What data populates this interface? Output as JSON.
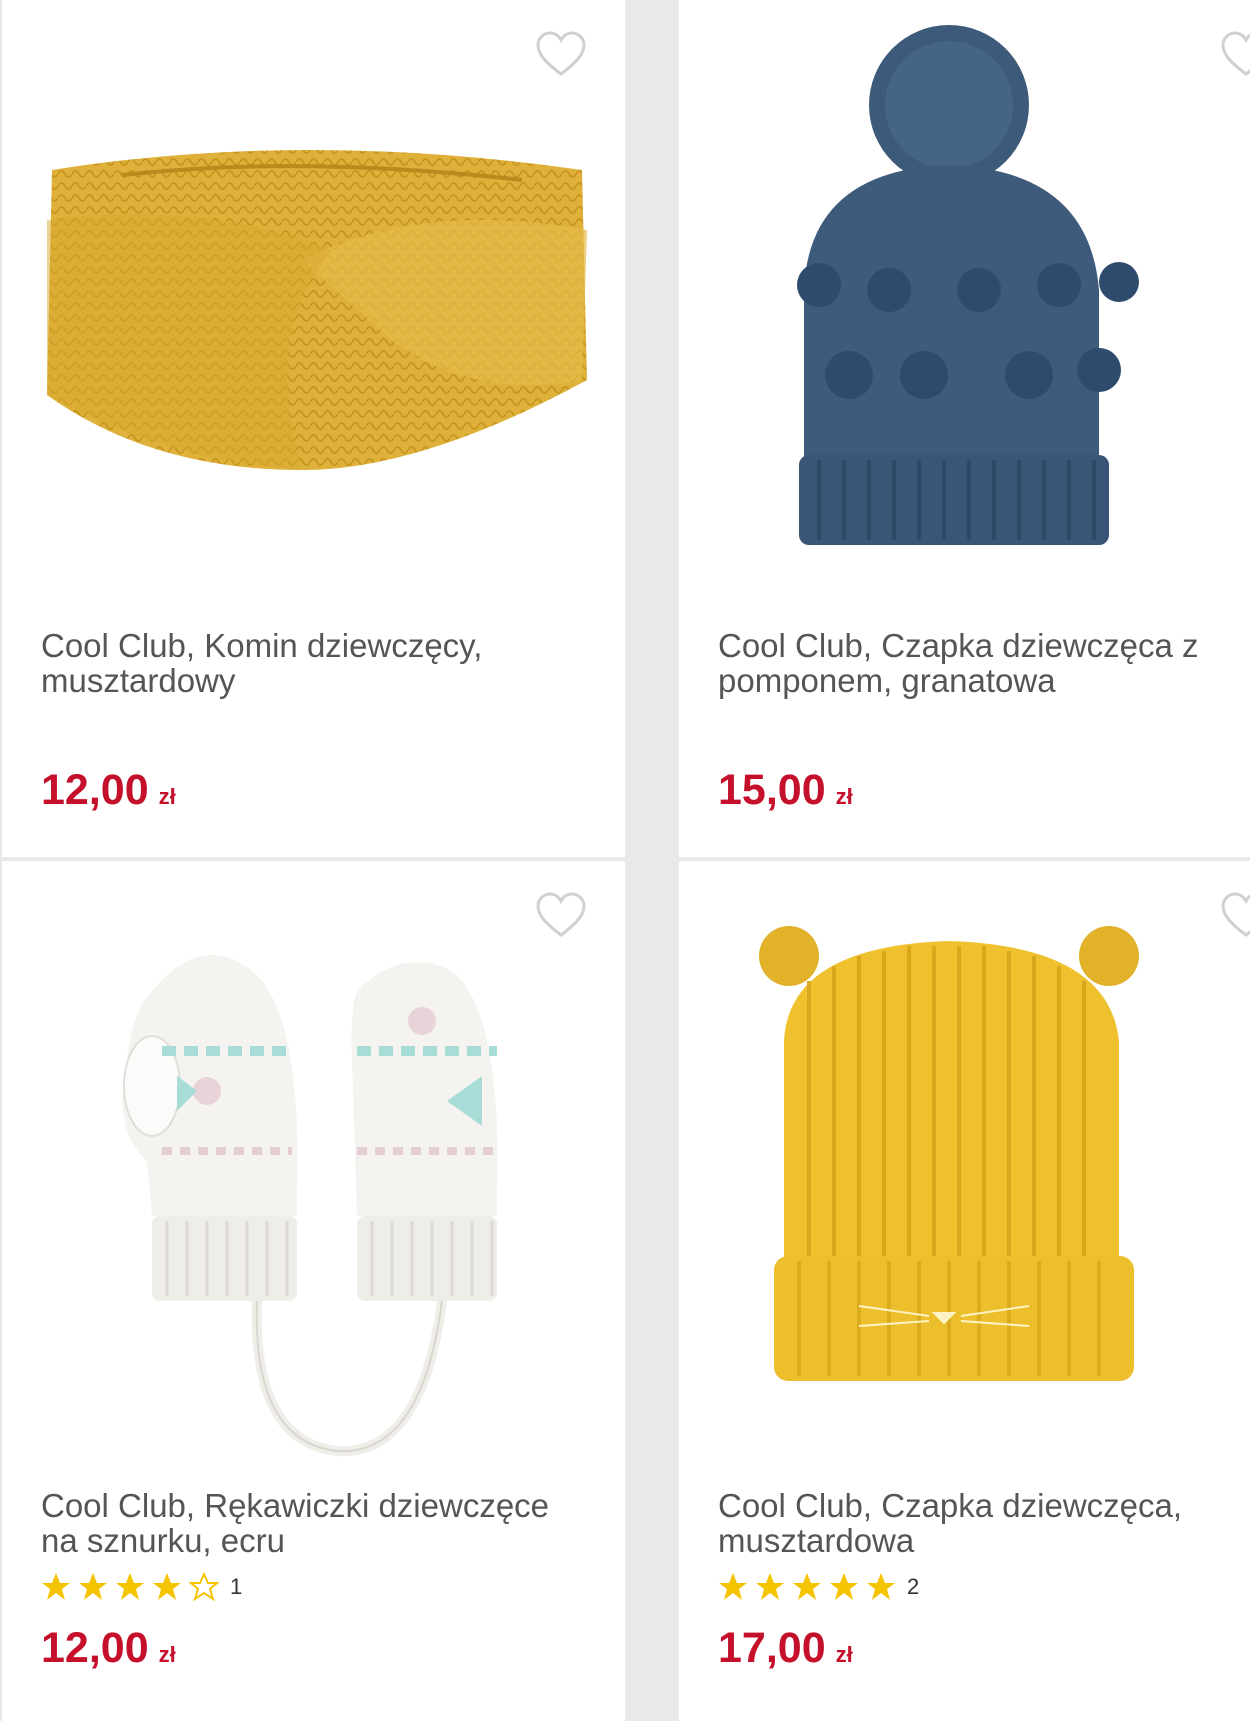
{
  "products": [
    {
      "title": "Cool Club, Komin dziewczęcy, musztardowy",
      "price": "12,00",
      "currency": "zł",
      "image_icon": "knit-headband-mustard-icon",
      "favorite_icon": "heart-outline-icon"
    },
    {
      "title": "Cool Club, Czapka dziewczęca z pomponem, granatowa",
      "price": "15,00",
      "currency": "zł",
      "image_icon": "pompom-beanie-navy-icon",
      "favorite_icon": "heart-outline-icon"
    },
    {
      "title": "Cool Club, Rękawiczki dziewczęce na sznurku, ecru",
      "price": "12,00",
      "currency": "zł",
      "rating": {
        "stars": 4,
        "max": 5,
        "count": "1"
      },
      "image_icon": "mittens-on-string-ecru-icon",
      "favorite_icon": "heart-outline-icon"
    },
    {
      "title": "Cool Club, Czapka dziewczęca, musztardowa",
      "price": "17,00",
      "currency": "zł",
      "rating": {
        "stars": 5,
        "max": 5,
        "count": "2"
      },
      "image_icon": "cat-ear-beanie-mustard-icon",
      "favorite_icon": "heart-outline-icon"
    }
  ],
  "colors": {
    "price": "#c4102b",
    "star": "#f5c400",
    "title": "#555555",
    "background": "#e9e9e9",
    "card": "#ffffff"
  }
}
